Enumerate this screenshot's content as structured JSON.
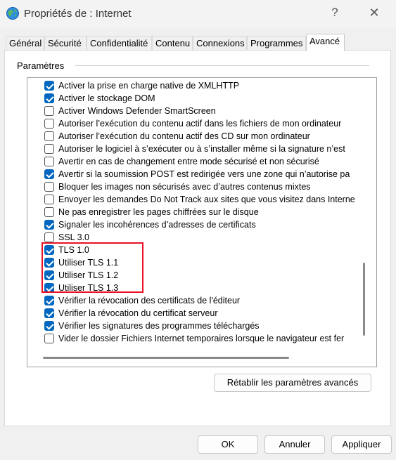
{
  "window": {
    "title": "Propriétés de : Internet",
    "help": "?",
    "close": "✕"
  },
  "tabs": [
    {
      "label": "Général"
    },
    {
      "label": "Sécurité"
    },
    {
      "label": "Confidentialité"
    },
    {
      "label": "Contenu"
    },
    {
      "label": "Connexions"
    },
    {
      "label": "Programmes"
    },
    {
      "label": "Avancé",
      "active": true
    }
  ],
  "group_label": "Paramètres",
  "settings": [
    {
      "label": "Activer la prise en charge native de XMLHTTP",
      "checked": true
    },
    {
      "label": "Activer le stockage DOM",
      "checked": true
    },
    {
      "label": "Activer Windows Defender SmartScreen",
      "checked": false
    },
    {
      "label": "Autoriser l’exécution du contenu actif dans les fichiers de mon ordinateur",
      "checked": false
    },
    {
      "label": "Autoriser l’exécution du contenu actif des CD sur mon ordinateur",
      "checked": false
    },
    {
      "label": "Autoriser le logiciel à s’exécuter ou à s’installer même si la signature n’est",
      "checked": false
    },
    {
      "label": "Avertir en cas de changement entre mode sécurisé et non sécurisé",
      "checked": false
    },
    {
      "label": "Avertir si la soumission POST est redirigée vers une zone qui n’autorise pa",
      "checked": true
    },
    {
      "label": "Bloquer les images non sécurisés avec d’autres contenus mixtes",
      "checked": false
    },
    {
      "label": "Envoyer les demandes Do Not Track aux sites que vous visitez dans Interne",
      "checked": false
    },
    {
      "label": "Ne pas enregistrer les pages chiffrées sur le disque",
      "checked": false
    },
    {
      "label": "Signaler les incohérences d’adresses de certificats",
      "checked": true
    },
    {
      "label": "SSL 3.0",
      "checked": false
    },
    {
      "label": "TLS 1.0",
      "checked": true
    },
    {
      "label": "Utiliser TLS 1.1",
      "checked": true
    },
    {
      "label": "Utiliser TLS 1.2",
      "checked": true
    },
    {
      "label": "Utiliser TLS 1.3",
      "checked": true
    },
    {
      "label": "Vérifier la révocation des certificats de l'éditeur",
      "checked": true
    },
    {
      "label": "Vérifier la révocation du certificat serveur",
      "checked": true
    },
    {
      "label": "Vérifier les signatures des programmes téléchargés",
      "checked": true
    },
    {
      "label": "Vider le dossier Fichiers Internet temporaires lorsque le navigateur est fer",
      "checked": false
    }
  ],
  "reset_button": "Rétablir les paramètres avancés",
  "buttons": {
    "ok": "OK",
    "cancel": "Annuler",
    "apply": "Appliquer"
  },
  "colors": {
    "checkbox_checked": "#0067c0",
    "highlight": "#e81123"
  }
}
